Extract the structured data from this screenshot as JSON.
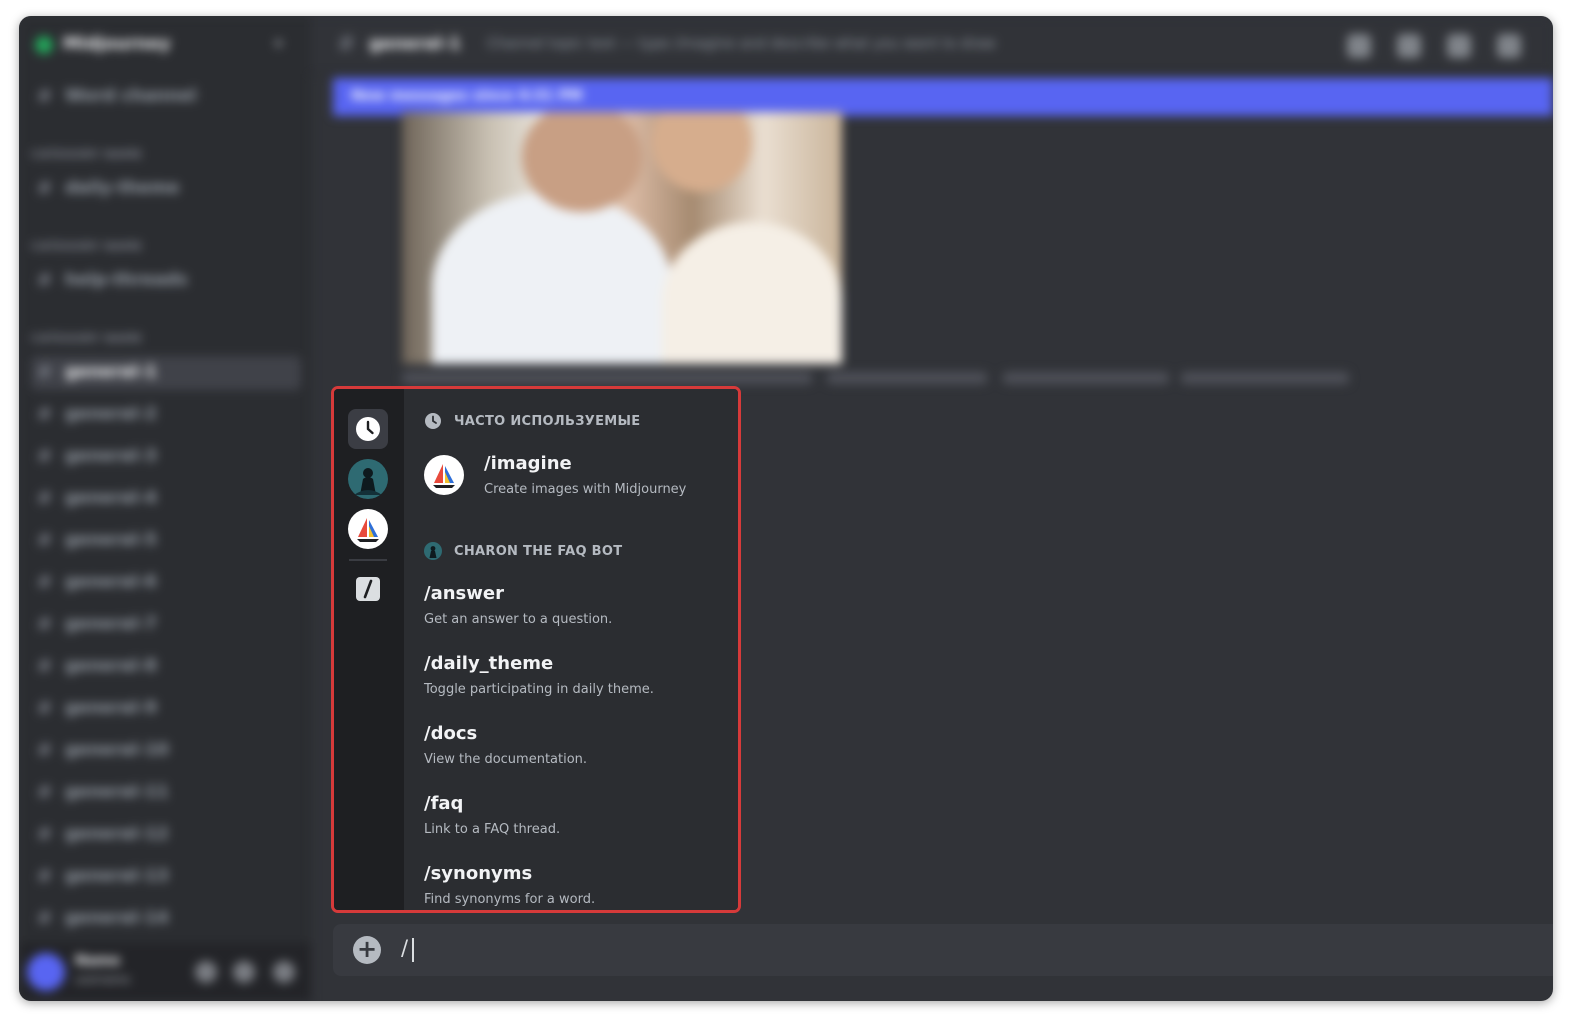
{
  "colors": {
    "accent": "#5865f2",
    "highlight_border": "#d63a3a",
    "online": "#23a55a"
  },
  "composer": {
    "value": "/"
  },
  "command_popup": {
    "frequent_section": {
      "title": "ЧАСТО ИСПОЛЬЗУЕМЫЕ",
      "icon": "clock-icon",
      "commands": [
        {
          "name": "/imagine",
          "description": "Create images with Midjourney",
          "icon": "midjourney-boat-icon"
        }
      ]
    },
    "bot_section": {
      "title": "CHARON THE FAQ BOT",
      "icon": "charon-bot-avatar",
      "commands": [
        {
          "name": "/answer",
          "description": "Get an answer to a question."
        },
        {
          "name": "/daily_theme",
          "description": "Toggle participating in daily theme."
        },
        {
          "name": "/docs",
          "description": "View the documentation."
        },
        {
          "name": "/faq",
          "description": "Link to a FAQ thread."
        },
        {
          "name": "/synonyms",
          "description": "Find synonyms for a word."
        }
      ]
    },
    "rail_icons": [
      "clock-icon",
      "charon-bot-avatar",
      "midjourney-boat-icon",
      "slash-commands-icon"
    ]
  }
}
